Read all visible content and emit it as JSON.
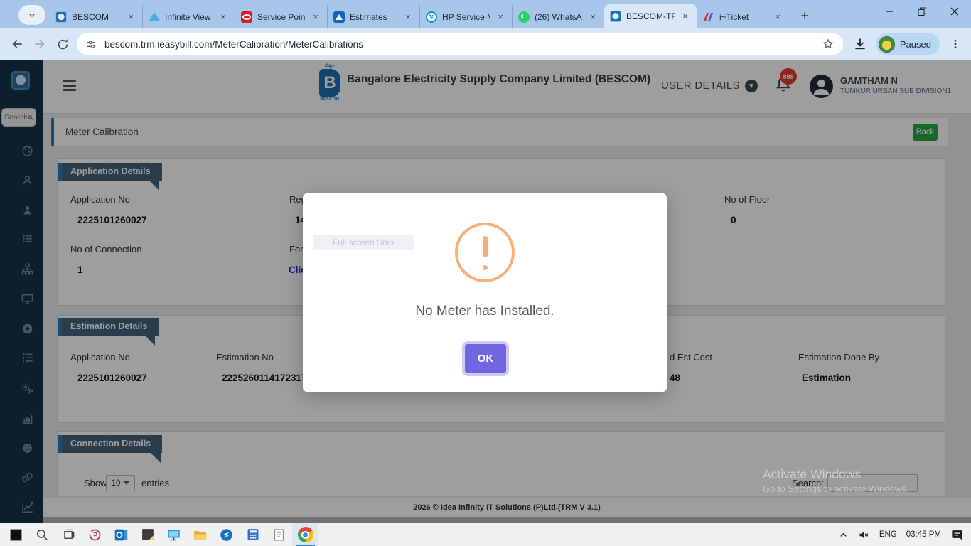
{
  "browser": {
    "tabs": [
      {
        "label": "BESCOM"
      },
      {
        "label": "Infinite View"
      },
      {
        "label": "Service Point"
      },
      {
        "label": "Estimates"
      },
      {
        "label": "HP Service M"
      },
      {
        "label": "(26) WhatsA"
      },
      {
        "label": "BESCOM-TR"
      },
      {
        "label": "i~Ticket"
      }
    ],
    "url": "bescom.trm.ieasybill.com/MeterCalibration/MeterCalibrations",
    "extension_badge": "Paused"
  },
  "sidebar": {
    "search_placeholder": "Search",
    "icon_names": [
      "dashboard",
      "user",
      "user-alt",
      "list",
      "sitemap",
      "desktop",
      "plus-circle",
      "ordered-list",
      "settings-gears",
      "bar-chart",
      "palette",
      "ticket",
      "line-chart"
    ]
  },
  "header": {
    "company": "Bangalore Electricity Supply Company Limited (BESCOM)",
    "user_details_label": "USER DETAILS",
    "notification_count": "898",
    "user_name": "GAMTHAM N",
    "user_division": "TUMKUR URBAN SUB DIVISION1"
  },
  "page": {
    "title": "Meter Calibration",
    "back_label": "Back",
    "application_details": {
      "section_title": "Application Details",
      "fields": [
        {
          "label": "Application No",
          "value": "2225101260027"
        },
        {
          "label": "Reg",
          "value": "14"
        },
        {
          "label": "No of Floor",
          "value": "0"
        },
        {
          "label": "No of Connection",
          "value": "1"
        },
        {
          "label": "For A",
          "value": "Click"
        }
      ]
    },
    "estimation_details": {
      "section_title": "Estimation Details",
      "fields": [
        {
          "label": "Application No",
          "value": "2225101260027"
        },
        {
          "label": "Estimation No",
          "value": "2225260114172317"
        },
        {
          "label": "d Est Cost",
          "value": "48"
        },
        {
          "label": "Estimation Done By",
          "value": "Estimation"
        }
      ]
    },
    "connection_details": {
      "section_title": "Connection Details",
      "show_label": "Show",
      "page_size": "10",
      "entries_label": "entries",
      "search_label": "Search:"
    },
    "footer": "2026 © Idea Infinity IT Solutions (P)Ltd.(TRM V 3.1)"
  },
  "modal": {
    "message": "No Meter has Installed.",
    "confirm_label": "OK",
    "snip_artifact": "Full screen Snip"
  },
  "watermark": {
    "line1": "Activate Windows",
    "line2": "Go to Settings to activate Windows."
  },
  "taskbar": {
    "language": "ENG",
    "time": "03:45 PM"
  },
  "colors": {
    "chrome_theme": "#a7c6ea",
    "sidebar_bg": "#14334a",
    "section_badge": "#46617a",
    "accent_blue": "#2779bd",
    "back_button_green": "#28a745",
    "notification_red": "#e53935",
    "modal_confirm_purple": "#7066e0",
    "warning_orange": "#f3b079"
  }
}
